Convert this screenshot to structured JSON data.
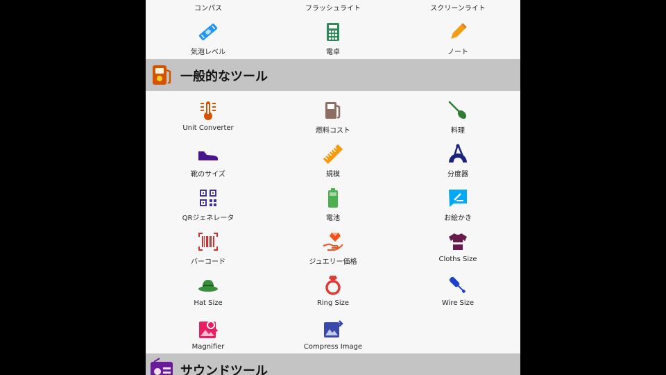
{
  "top_labels": [
    "コンパス",
    "フラッシュライト",
    "スクリーンライト"
  ],
  "row0": [
    {
      "label": "気泡レベル",
      "icon": "bubble-level-icon",
      "color": "#2196f3"
    },
    {
      "label": "電卓",
      "icon": "calculator-icon",
      "color": "#2e8b57"
    },
    {
      "label": "ノート",
      "icon": "pencil-icon",
      "color": "#f39c12"
    }
  ],
  "section_general": {
    "title": "一般的なツール",
    "icon": "fuel-pump-icon"
  },
  "general_tools": [
    {
      "label": "Unit Converter",
      "icon": "thermometer-icon",
      "color": "#d35400"
    },
    {
      "label": "燃料コスト",
      "icon": "fuel-icon",
      "color": "#8d6e63"
    },
    {
      "label": "料理",
      "icon": "spatula-icon",
      "color": "#2e7d32"
    },
    {
      "label": "靴のサイズ",
      "icon": "shoe-icon",
      "color": "#4a148c"
    },
    {
      "label": "規模",
      "icon": "ruler-icon",
      "color": "#f39c12"
    },
    {
      "label": "分度器",
      "icon": "protractor-icon",
      "color": "#1a237e"
    },
    {
      "label": "QRジェネレータ",
      "icon": "qr-code-icon",
      "color": "#3f2fa0"
    },
    {
      "label": "電池",
      "icon": "battery-icon",
      "color": "#4caf50"
    },
    {
      "label": "お絵かき",
      "icon": "drawing-icon",
      "color": "#03a9f4"
    },
    {
      "label": "バーコード",
      "icon": "barcode-icon",
      "color": "#d32f2f"
    },
    {
      "label": "ジュエリー価格",
      "icon": "jewelry-icon",
      "color": "#f4511e"
    },
    {
      "label": "Cloths Size",
      "icon": "shirt-icon",
      "color": "#6a1b4d"
    },
    {
      "label": "Hat Size",
      "icon": "hat-icon",
      "color": "#388e3c"
    },
    {
      "label": "Ring Size",
      "icon": "ring-icon",
      "color": "#e53935"
    },
    {
      "label": "Wire Size",
      "icon": "wire-icon",
      "color": "#1e40c8"
    },
    {
      "label": "Magnifier",
      "icon": "magnifier-icon",
      "color": "#e91e63"
    },
    {
      "label": "Compress Image",
      "icon": "compress-image-icon",
      "color": "#3949ab"
    }
  ],
  "section_sound": {
    "title": "サウンドツール",
    "icon": "radio-icon"
  }
}
